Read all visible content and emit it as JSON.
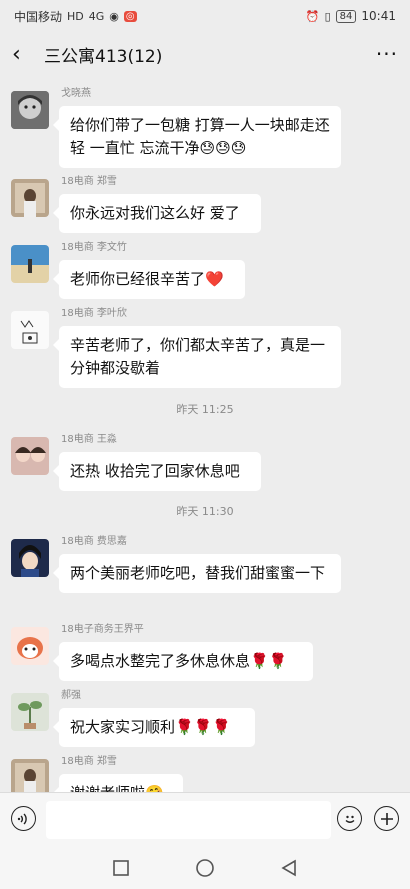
{
  "status_bar": {
    "carrier": "中国移动",
    "hd": "HD",
    "signal": "4G",
    "battery": "84",
    "time": "10:41"
  },
  "header": {
    "title": "三公寓413(12)"
  },
  "colors": {
    "background": "#ededed",
    "bubble": "#ffffff",
    "name": "#8a8a8a"
  },
  "messages": [
    {
      "sender": "戈晓燕",
      "text": "给你们带了一包糖 打算一人一块邮走还轻 一直忙 忘流干净😓😓😓"
    },
    {
      "sender": "18电商 郑雪",
      "text": "你永远对我们这么好 爱了"
    },
    {
      "sender": "18电商 李文竹",
      "text": "老师你已经很辛苦了❤️"
    },
    {
      "sender": "18电商 李叶欣",
      "text": "辛苦老师了，你们都太辛苦了，真是一分钟都没歇着"
    },
    {
      "sender": "18电商 王淼",
      "text": "还热 收拾完了回家休息吧"
    },
    {
      "sender": "18电商 费思嘉",
      "text": "两个美丽老师吃吧，替我们甜蜜蜜一下"
    },
    {
      "sender": "18电子商务王界平",
      "text": "多喝点水整完了多休息休息🌹🌹"
    },
    {
      "sender": "郝强",
      "text": "祝大家实习顺利🌹🌹🌹"
    },
    {
      "sender": "18电商 郑雪",
      "text": "谢谢老师啦🤗"
    }
  ],
  "timestamps": [
    "昨天 11:25",
    "昨天 11:30"
  ]
}
